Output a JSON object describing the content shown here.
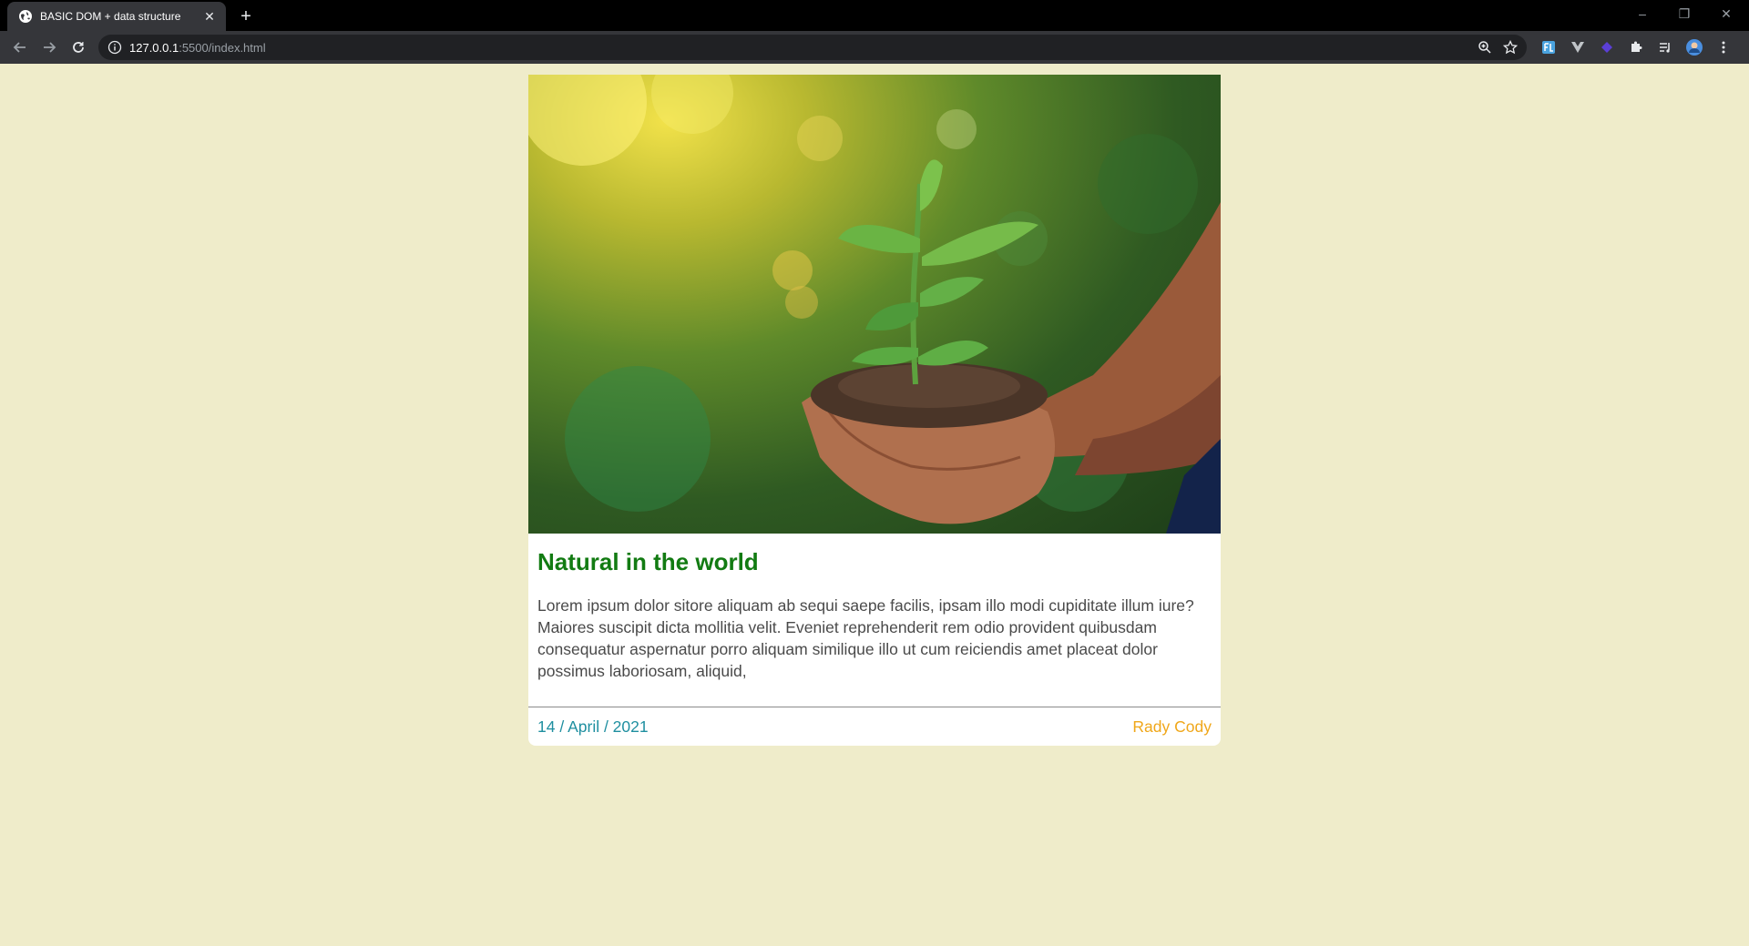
{
  "browser": {
    "tab_title": "BASIC DOM + data structure",
    "tab_close": "✕",
    "new_tab": "+",
    "url_host": "127.0.0.1",
    "url_path": ":5500/index.html",
    "window_controls": [
      "–",
      "❐",
      "✕"
    ]
  },
  "card": {
    "image_alt": "Hands holding a young plant seedling in soil",
    "title": "Natural in the world",
    "text": "Lorem ipsum dolor sitore aliquam ab sequi saepe facilis, ipsam illo modi cupiditate illum iure? Maiores suscipit dicta mollitia velit. Eveniet reprehenderit rem odio provident quibusdam consequatur aspernatur porro aliquam similique illo ut cum reiciendis amet placeat dolor possimus laboriosam, aliquid,",
    "date": "14 / April / 2021",
    "author": "Rady Cody"
  },
  "colors": {
    "page_bg": "#efecca",
    "title": "#127b12",
    "date": "#1f8fa0",
    "author": "#f0a71a"
  }
}
